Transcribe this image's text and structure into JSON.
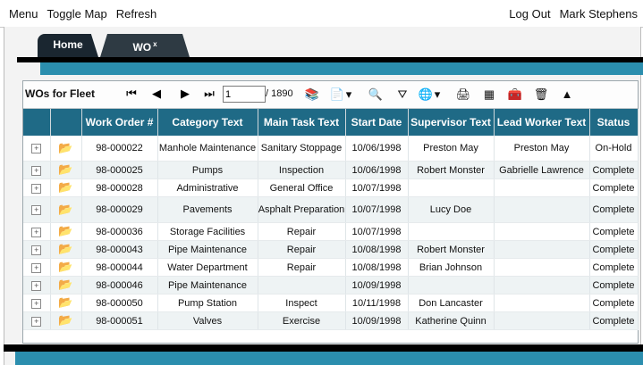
{
  "topbar": {
    "menu": "Menu",
    "toggle_map": "Toggle Map",
    "refresh": "Refresh",
    "logout": "Log Out",
    "user": "Mark Stephens"
  },
  "tabs": {
    "home": "Home",
    "wo": "WO",
    "wo_close": "x"
  },
  "grid": {
    "title": "WOs for Fleet",
    "page_value": "1",
    "page_total": "/ 1890",
    "columns": [
      "",
      "",
      "Work Order #",
      "Category Text",
      "Main Task Text",
      "Start Date",
      "Supervisor Text",
      "Lead Worker Text",
      "Status"
    ],
    "rows": [
      {
        "wo": "98-000022",
        "category": "Manhole Maintenance",
        "task": "Sanitary Stoppage",
        "date": "10/06/1998",
        "supervisor": "Preston May",
        "lead": "Preston May",
        "status": "On-Hold"
      },
      {
        "wo": "98-000025",
        "category": "Pumps",
        "task": "Inspection",
        "date": "10/06/1998",
        "supervisor": "Robert Monster",
        "lead": "Gabrielle Lawrence",
        "status": "Complete"
      },
      {
        "wo": "98-000028",
        "category": "Administrative",
        "task": "General Office",
        "date": "10/07/1998",
        "supervisor": "",
        "lead": "",
        "status": "Complete"
      },
      {
        "wo": "98-000029",
        "category": "Pavements",
        "task": "Asphalt Preparation",
        "date": "10/07/1998",
        "supervisor": "Lucy Doe",
        "lead": "",
        "status": "Complete"
      },
      {
        "wo": "98-000036",
        "category": "Storage Facilities",
        "task": "Repair",
        "date": "10/07/1998",
        "supervisor": "",
        "lead": "",
        "status": "Complete"
      },
      {
        "wo": "98-000043",
        "category": "Pipe Maintenance",
        "task": "Repair",
        "date": "10/08/1998",
        "supervisor": "Robert Monster",
        "lead": "",
        "status": "Complete"
      },
      {
        "wo": "98-000044",
        "category": "Water Department",
        "task": "Repair",
        "date": "10/08/1998",
        "supervisor": "Brian Johnson",
        "lead": "",
        "status": "Complete"
      },
      {
        "wo": "98-000046",
        "category": "Pipe Maintenance",
        "task": "",
        "date": "10/09/1998",
        "supervisor": "",
        "lead": "",
        "status": "Complete"
      },
      {
        "wo": "98-000050",
        "category": "Pump Station",
        "task": "Inspect",
        "date": "10/11/1998",
        "supervisor": "Don Lancaster",
        "lead": "",
        "status": "Complete"
      },
      {
        "wo": "98-000051",
        "category": "Valves",
        "task": "Exercise",
        "date": "10/09/1998",
        "supervisor": "Katherine Quinn",
        "lead": "",
        "status": "Complete"
      }
    ]
  },
  "icons": {
    "first": "first-page-icon",
    "prev": "prev-page-icon",
    "next": "next-page-icon",
    "last": "last-page-icon"
  }
}
